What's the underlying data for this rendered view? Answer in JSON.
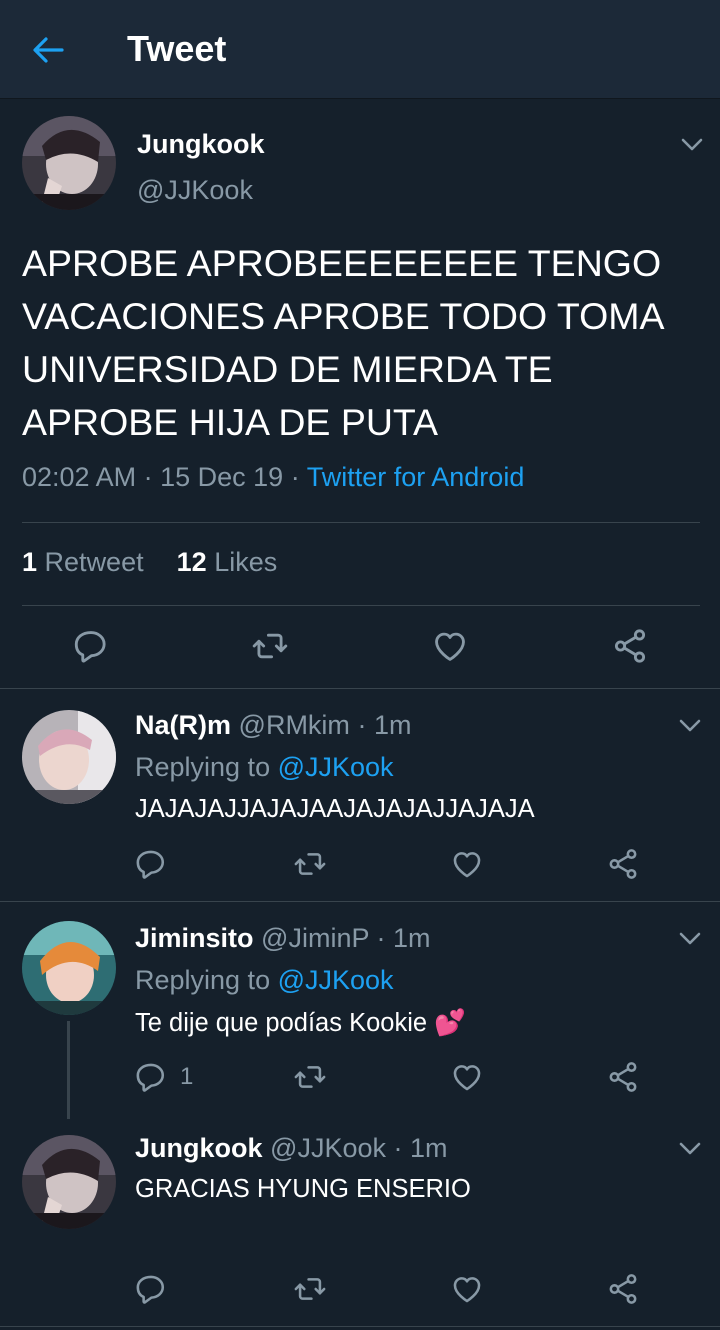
{
  "header": {
    "title": "Tweet",
    "back_icon": "arrow-left-icon"
  },
  "colors": {
    "background": "#15202b",
    "header": "#1c2938",
    "accent": "#1da1f2",
    "muted": "#8899a6",
    "divider": "#38444d"
  },
  "main_tweet": {
    "name": "Jungkook",
    "handle": "@JJKook",
    "text": "APROBE APROBEEEEEEEE TENGO VACACIONES APROBE TODO TOMA UNIVERSIDAD DE MIERDA TE APROBE HIJA DE PUTA",
    "time": "02:02 AM",
    "date": "15 Dec 19",
    "source": "Twitter for Android",
    "retweet_count": "1",
    "retweet_label": "Retweet",
    "like_count": "12",
    "like_label": "Likes"
  },
  "replies": [
    {
      "name": "Na(R)m",
      "handle": "@RMkim",
      "time": "1m",
      "replying_label": "Replying to",
      "replying_to": "@JJKook",
      "text": "JAJAJAJJAJAJAAJAJAJAJJAJAJA"
    },
    {
      "name": "Jiminsito",
      "handle": "@JiminP",
      "time": "1m",
      "replying_label": "Replying to",
      "replying_to": "@JJKook",
      "text": "Te dije que podías Kookie 💕",
      "reply_count": "1"
    },
    {
      "name": "Jungkook",
      "handle": "@JJKook",
      "time": "1m",
      "text": "GRACIAS HYUNG ENSERIO"
    }
  ],
  "separator": "·"
}
